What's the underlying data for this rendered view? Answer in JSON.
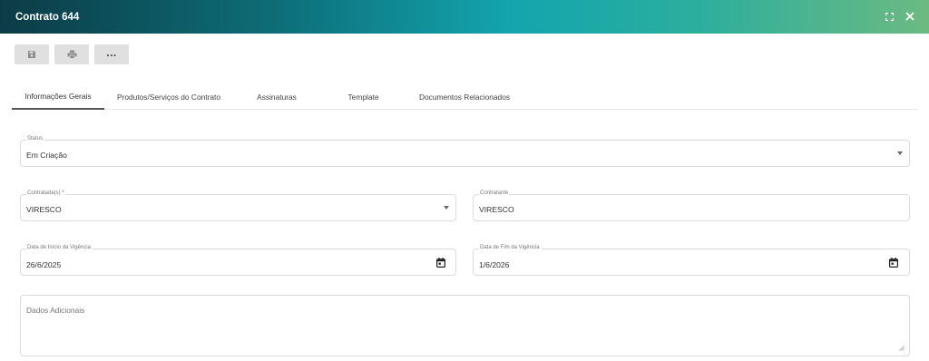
{
  "window": {
    "title": "Contrato 644"
  },
  "tabs": [
    {
      "label": "Informações Gerais"
    },
    {
      "label": "Produtos/Serviços do Contrato"
    },
    {
      "label": "Assinaturas"
    },
    {
      "label": "Template"
    },
    {
      "label": "Documentos Relacionados"
    }
  ],
  "form": {
    "status": {
      "label": "Status",
      "value": "Em Criação"
    },
    "contratada": {
      "label": "Contratada(s) *",
      "value": "VIRESCO"
    },
    "contratante": {
      "label": "Contratante",
      "value": "VIRESCO"
    },
    "inicio": {
      "label": "Data de Início da Vigência",
      "value": "26/6/2025"
    },
    "fim": {
      "label": "Data de Fim da Vigência",
      "value": "1/6/2026"
    },
    "dados": {
      "placeholder": "Dados Adicionais"
    }
  }
}
